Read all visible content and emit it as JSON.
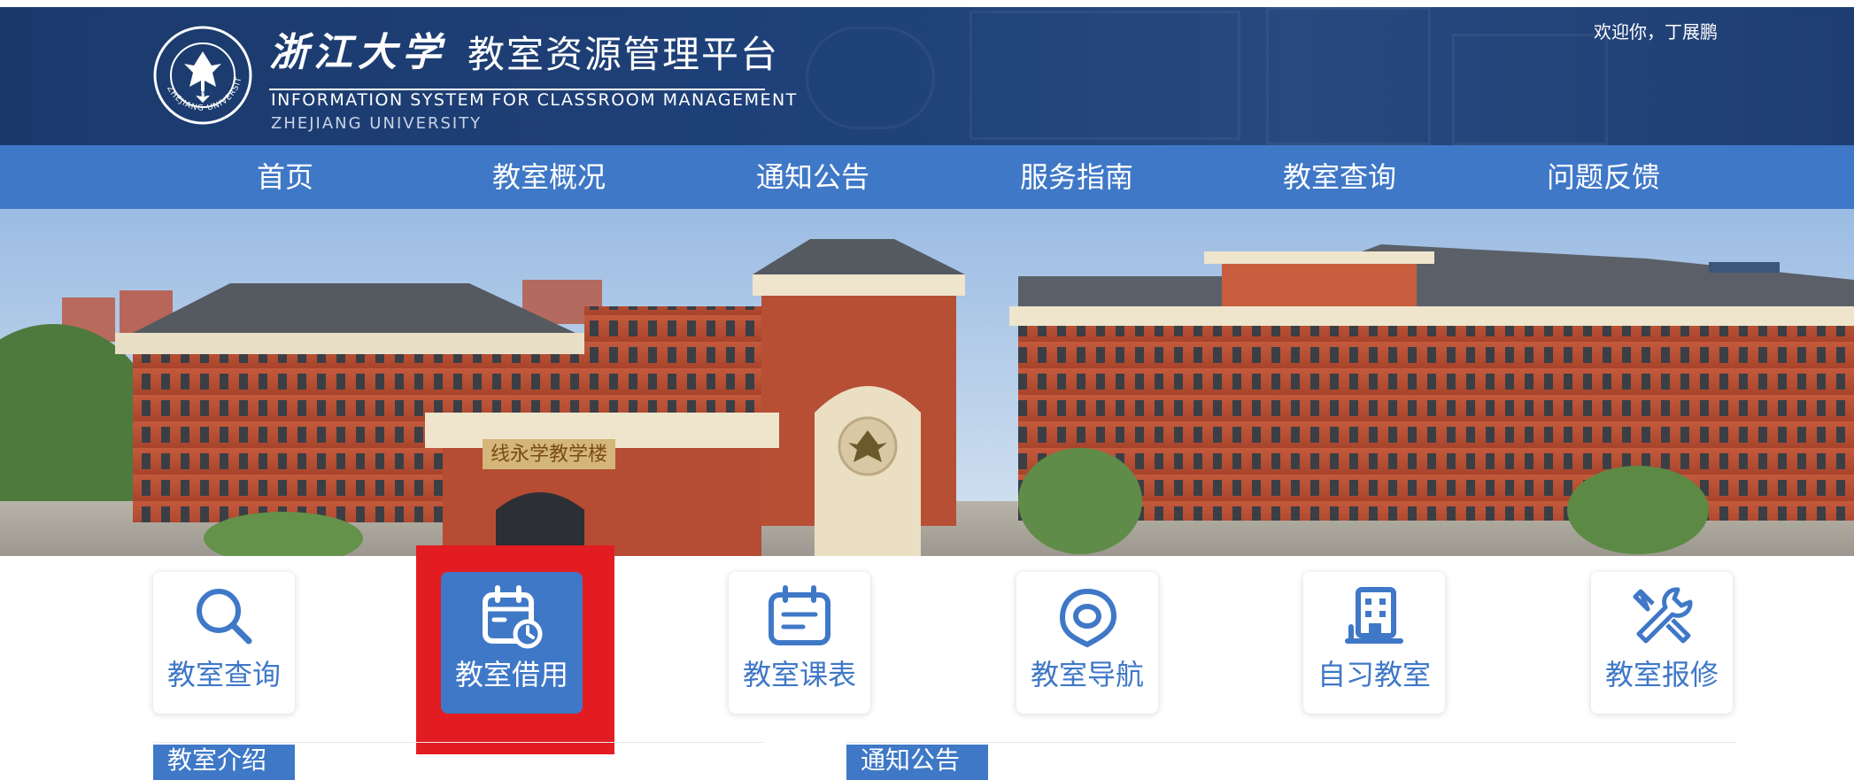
{
  "header": {
    "brand_calligraphy": "浙江大学",
    "platform_title": "教室资源管理平台",
    "subtitle_en": "INFORMATION SYSTEM FOR CLASSROOM MANAGEMENT",
    "university_en": "ZHEJIANG UNIVERSITY",
    "seal_year": "1897",
    "seal_text": "ZHEJIANG UNIVERSITY",
    "welcome": "欢迎你，丁展鹏"
  },
  "nav": {
    "items": [
      {
        "label": "首页"
      },
      {
        "label": "教室概况"
      },
      {
        "label": "通知公告"
      },
      {
        "label": "服务指南"
      },
      {
        "label": "教室查询"
      },
      {
        "label": "问题反馈"
      }
    ]
  },
  "hero": {
    "building_sign": "线永学教学楼"
  },
  "tiles": [
    {
      "label": "教室查询",
      "icon": "search-icon",
      "active": false
    },
    {
      "label": "教室借用",
      "icon": "calendar-clock-icon",
      "active": true
    },
    {
      "label": "教室课表",
      "icon": "calendar-list-icon",
      "active": false
    },
    {
      "label": "教室导航",
      "icon": "location-pin-icon",
      "active": false
    },
    {
      "label": "自习教室",
      "icon": "building-icon",
      "active": false
    },
    {
      "label": "教室报修",
      "icon": "repair-tools-icon",
      "active": false
    }
  ],
  "panels": {
    "left_title": "教室介绍",
    "right_title": "通知公告"
  },
  "colors": {
    "header_bg": "#1f417a",
    "nav_bg": "#3f78c7",
    "accent": "#3f78c7",
    "highlight": "#e31c22"
  }
}
